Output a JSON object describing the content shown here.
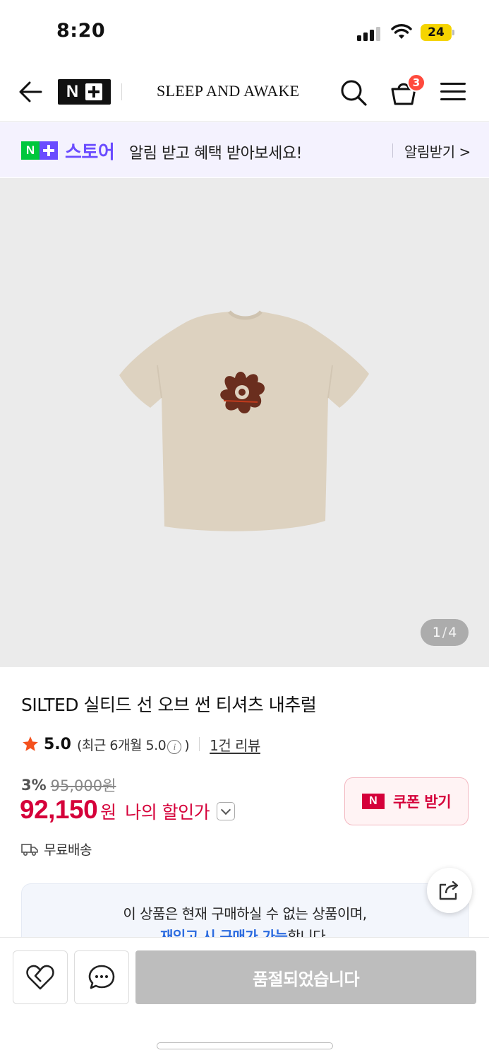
{
  "status_bar": {
    "time": "8:20",
    "battery": "24"
  },
  "header": {
    "logo_text": "N",
    "brand": "SLEEP AND AWAKE",
    "cart_count": "3"
  },
  "promo": {
    "logo_n": "N",
    "store": "스토어",
    "text": "알림 받고 혜택 받아보세요!",
    "link": "알림받기 >"
  },
  "gallery": {
    "current": "1",
    "separator": "/",
    "total": "4"
  },
  "product": {
    "title": "SILTED 실티드 선 오브 썬 티셔츠 내추럴",
    "rating": "5.0",
    "rating_detail_prefix": "(최근 6개월 5.0",
    "rating_detail_suffix": ")",
    "info_symbol": "i",
    "review_link": "1건 리뷰",
    "discount_rate": "3%",
    "original_price": "95,000원",
    "price": "92,150",
    "price_unit": "원",
    "price_label": "나의 할인가",
    "coupon_icon": "N",
    "coupon_label": "쿠폰 받기",
    "shipping": "무료배송"
  },
  "notice": {
    "line1": "이 상품은 현재 구매하실 수 없는 상품이며,",
    "line2_highlight": "재입고 시 구매가 가능",
    "line2_rest": "합니다."
  },
  "bottom_bar": {
    "soldout_label": "품절되었습니다"
  },
  "colors": {
    "accent_red": "#d5003a",
    "naver_green": "#00c73c",
    "plus_purple": "#6a4cff",
    "badge_red": "#ff4a3d"
  }
}
